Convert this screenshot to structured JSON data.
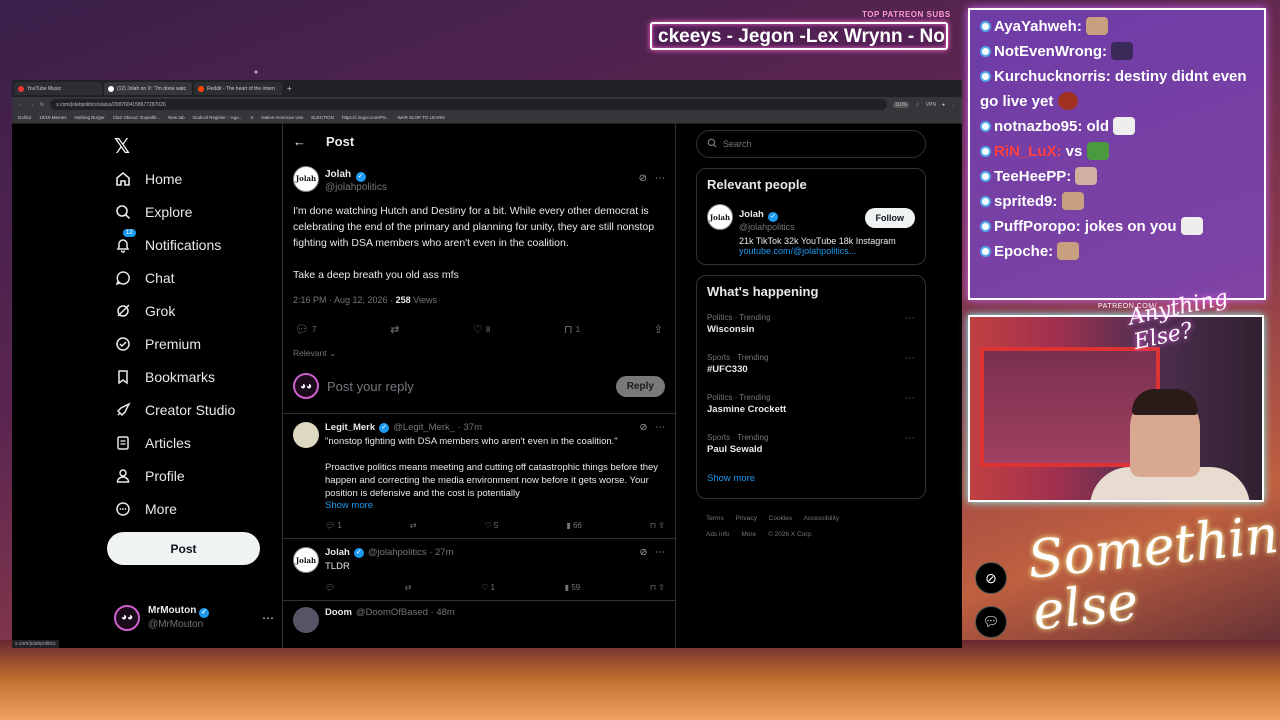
{
  "overlay": {
    "patreon_label": "TOP PATREON SUBS",
    "ticker": "ckeeys - Jegon -Lex Wrynn -  No",
    "patreon_cam": "PATREON.COM/",
    "script_small": "Anything Else?",
    "script_large": "Something else"
  },
  "browser": {
    "tabs": [
      {
        "label": "YouTube Music"
      },
      {
        "label": "(12) Jolah on X: \"I'm done watc"
      },
      {
        "label": "Reddit - The heart of the intern"
      }
    ],
    "url": "x.com/jolahpolitics/status/2087604158677287026",
    "zoom": "110%",
    "vpn": "VPN",
    "bookmarks": [
      "Dollics",
      "10/18 Memes",
      "Nothing Burger",
      "Clair Obscur: Expediti...",
      "New tab",
      "Godcoil Register :: Agu...",
      "X",
      "Native American Use",
      "ELECTION",
      "https://i.imgur.com/PS...",
      "WAR SLOP TO LEARN"
    ],
    "status_url": "x.com/jolahpolitics"
  },
  "nav": {
    "items": [
      {
        "label": "Home",
        "icon": "home-icon"
      },
      {
        "label": "Explore",
        "icon": "search-icon"
      },
      {
        "label": "Notifications",
        "icon": "bell-icon",
        "badge": "12"
      },
      {
        "label": "Chat",
        "icon": "chat-icon"
      },
      {
        "label": "Grok",
        "icon": "grok-icon"
      },
      {
        "label": "Premium",
        "icon": "premium-icon"
      },
      {
        "label": "Bookmarks",
        "icon": "bookmark-icon"
      },
      {
        "label": "Creator Studio",
        "icon": "rocket-icon"
      },
      {
        "label": "Articles",
        "icon": "articles-icon"
      },
      {
        "label": "Profile",
        "icon": "person-icon"
      },
      {
        "label": "More",
        "icon": "more-icon"
      }
    ],
    "post_button": "Post",
    "account": {
      "name": "MrMouton",
      "handle": "@MrMouton"
    }
  },
  "post": {
    "header": "Post",
    "author": {
      "name": "Jolah",
      "handle": "@jolahpolitics"
    },
    "text_1": "I'm done watching Hutch and Destiny for a bit. While every other democrat is celebrating the end of the primary and planning for unity, they are still nonstop fighting with DSA members who aren't even in the coalition.",
    "text_2": "Take a deep breath you old ass mfs",
    "time": "2:16 PM · Aug 12, 2026 · ",
    "views": "258",
    "views_label": " Views",
    "replies": "7",
    "likes": "8",
    "bookmarks": "1",
    "sort": "Relevant",
    "reply_placeholder": "Post your reply",
    "reply_button": "Reply"
  },
  "replies": [
    {
      "name": "Legit_Merk",
      "handle": "@Legit_Merk_ · 37m",
      "text_1": "\"nonstop fighting with DSA members who aren't even in the coalition.\"",
      "text_2": "Proactive politics means meeting and cutting off catastrophic things before they happen and correcting the media environment now before it gets worse. Your position is defensive and the cost is potentially",
      "show_more": "Show more",
      "replies": "1",
      "likes": "5",
      "views": "66"
    },
    {
      "name": "Jolah",
      "handle": "@jolahpolitics · 27m",
      "text_1": "TLDR",
      "likes": "1",
      "views": "59"
    },
    {
      "name": "Doom",
      "handle": "@DoomOfBased · 48m"
    }
  ],
  "sidebar": {
    "search_placeholder": "Search",
    "relevant_title": "Relevant people",
    "person": {
      "name": "Jolah",
      "handle": "@jolahpolitics",
      "bio": "21k TikTok 32k YouTube 18k Instagram",
      "link": "youtube.com/@jolahpolitics...",
      "follow": "Follow"
    },
    "happening_title": "What's happening",
    "trends": [
      {
        "category": "Politics · Trending",
        "topic": "Wisconsin"
      },
      {
        "category": "Sports · Trending",
        "topic": "#UFC330"
      },
      {
        "category": "Politics · Trending",
        "topic": "Jasmine Crockett"
      },
      {
        "category": "Sports · Trending",
        "topic": "Paul Sewald"
      }
    ],
    "show_more": "Show more",
    "footer": [
      "Terms",
      "Privacy",
      "Cookies",
      "Accessibility",
      "Ads info",
      "More",
      "© 2026 X Corp."
    ]
  },
  "chat": [
    {
      "user": "AyaYahweh:",
      "msg": ""
    },
    {
      "user": "NotEvenWrong:",
      "msg": ""
    },
    {
      "user": "Kurchucknorris:",
      "msg": " destiny didnt even go live yet"
    },
    {
      "user": "notnazbo95:",
      "msg": " old"
    },
    {
      "user": "RiN_LuX:",
      "msg": " vs"
    },
    {
      "user": "TeeHeePP:",
      "msg": ""
    },
    {
      "user": "sprited9:",
      "msg": ""
    },
    {
      "user": "PuffPoropo:",
      "msg": " jokes on you"
    },
    {
      "user": "Epoche:",
      "msg": ""
    }
  ]
}
